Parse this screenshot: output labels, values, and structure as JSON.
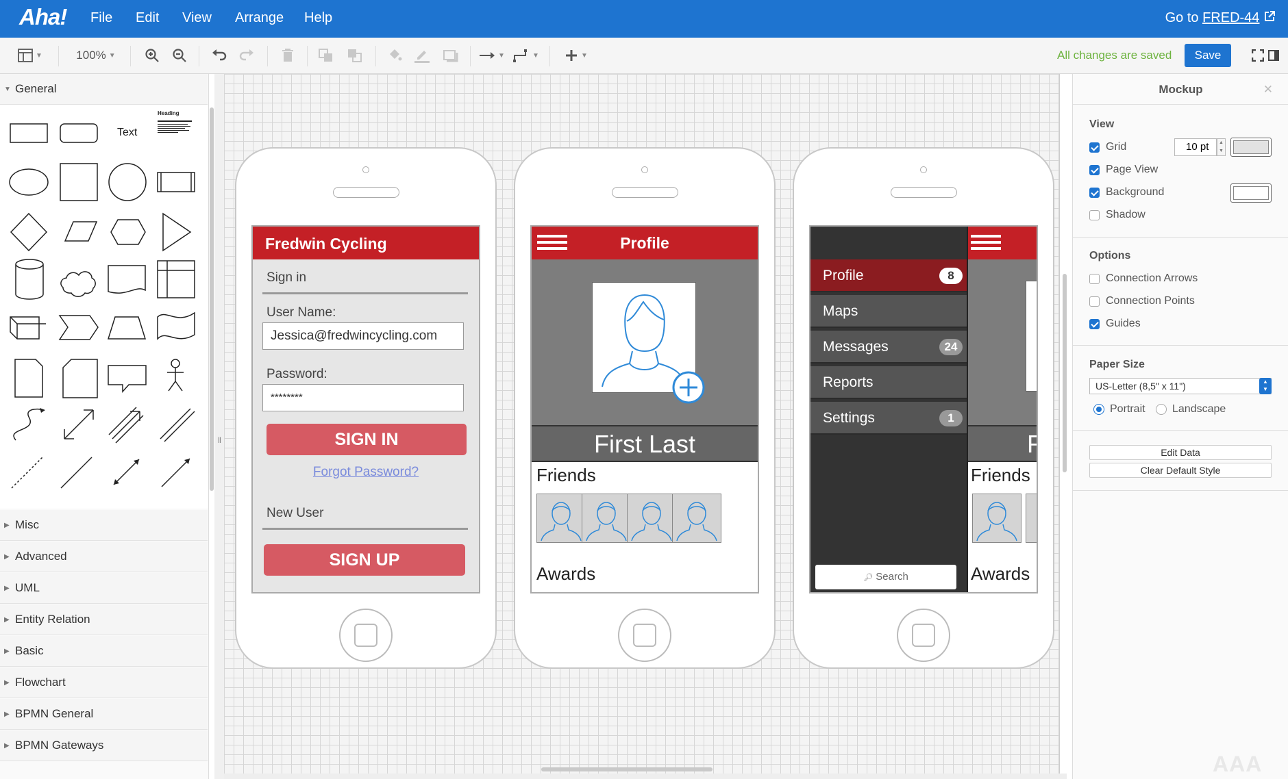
{
  "app": {
    "logo": "Aha!",
    "goto_prefix": "Go to ",
    "goto_link": "FRED-44"
  },
  "menu": [
    "File",
    "Edit",
    "View",
    "Arrange",
    "Help"
  ],
  "toolbar": {
    "zoom": "100%",
    "status": "All changes are saved",
    "save_label": "Save"
  },
  "sidebar": {
    "general": "General",
    "text_shape": "Text",
    "heading_shape": "Heading",
    "sections": [
      "Misc",
      "Advanced",
      "UML",
      "Entity Relation",
      "Basic",
      "Flowchart",
      "BPMN General",
      "BPMN Gateways"
    ]
  },
  "phone1": {
    "title": "Fredwin Cycling",
    "signin": "Sign in",
    "username_label": "User Name:",
    "username_value": "Jessica@fredwincycling.com",
    "password_label": "Password:",
    "password_value": "********",
    "signin_button": "SIGN IN",
    "forgot": "Forgot Password?",
    "new_user": "New User",
    "signup_button": "SIGN UP"
  },
  "phone2": {
    "title": "Profile",
    "name": "First Last",
    "friends": "Friends",
    "awards": "Awards"
  },
  "phone3": {
    "menu": [
      {
        "label": "Profile",
        "badge": "8"
      },
      {
        "label": "Maps",
        "badge": ""
      },
      {
        "label": "Messages",
        "badge": "24"
      },
      {
        "label": "Reports",
        "badge": ""
      },
      {
        "label": "Settings",
        "badge": "1"
      }
    ],
    "search": "Search",
    "name_partial": "F",
    "friends": "Friends",
    "awards": "Awards"
  },
  "panel": {
    "title": "Mockup",
    "view_label": "View",
    "grid": "Grid",
    "grid_size": "10 pt",
    "page_view": "Page View",
    "background": "Background",
    "shadow": "Shadow",
    "options_label": "Options",
    "connection_arrows": "Connection Arrows",
    "connection_points": "Connection Points",
    "guides": "Guides",
    "paper_size_label": "Paper Size",
    "paper_size": "US-Letter (8,5\" x 11\")",
    "portrait": "Portrait",
    "landscape": "Landscape",
    "edit_data": "Edit Data",
    "clear_style": "Clear Default Style"
  },
  "watermark": "AAA",
  "colors": {
    "brand_blue": "#1e74d0",
    "accent_red": "#c42026",
    "saved_green": "#6db33f"
  }
}
